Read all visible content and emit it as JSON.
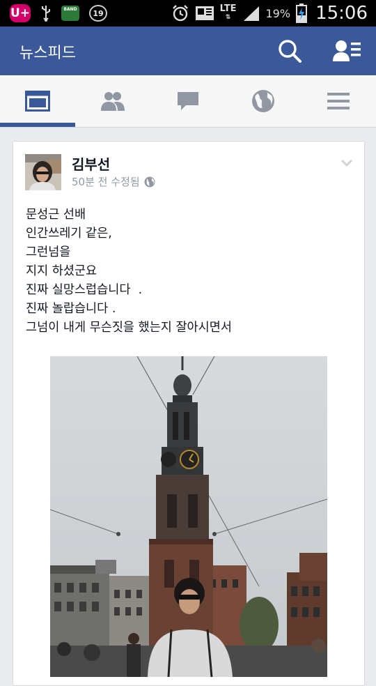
{
  "status_bar": {
    "carrier_logo": "U+",
    "band_app_label": "BAND",
    "notification_count": "19",
    "network": "LTE",
    "battery_percent": "19%",
    "time": "15:06",
    "icons": [
      "usb-icon",
      "alarm-icon",
      "sim-icon",
      "signal-icon",
      "battery-charging-icon"
    ]
  },
  "header": {
    "title": "뉴스피드",
    "color": "#3b5998",
    "search_icon": "search-icon",
    "friend_requests_icon": "friend-requests-icon"
  },
  "tabs": [
    {
      "id": "news-feed",
      "icon": "news-feed-icon",
      "active": true
    },
    {
      "id": "friends",
      "icon": "friends-icon",
      "active": false
    },
    {
      "id": "messages",
      "icon": "messages-icon",
      "active": false
    },
    {
      "id": "notifications",
      "icon": "globe-icon",
      "active": false
    },
    {
      "id": "more",
      "icon": "menu-icon",
      "active": false
    }
  ],
  "post": {
    "author": "김부선",
    "meta": "50분 전 수정됨",
    "privacy_icon": "globe-icon",
    "lines": [
      "문성근 선배",
      "인간쓰레기 같은,",
      "그런넘을",
      "지지 하셨군요",
      "진짜 실망스럽습니다  .",
      "진짜 놀랍습니다 .",
      "그넘이 내게 무슨짓을 했는지 잘아시면서"
    ]
  }
}
